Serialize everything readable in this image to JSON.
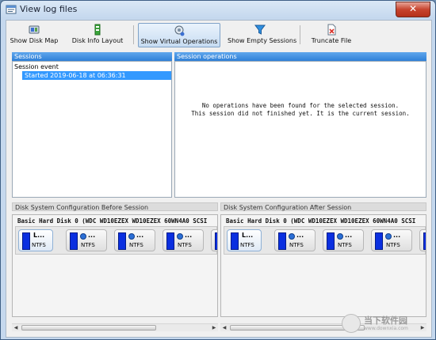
{
  "window": {
    "title": "View log files",
    "close_glyph": "✕"
  },
  "toolbar": {
    "buttons": [
      {
        "label": "Show Disk Map",
        "icon": "disk-map-icon",
        "active": false
      },
      {
        "label": "Disk Info Layout",
        "icon": "disk-info-icon",
        "active": false
      },
      {
        "label": "Show Virtual Operations",
        "icon": "virtual-ops-icon",
        "active": true
      },
      {
        "label": "Show Empty Sessions",
        "icon": "funnel-icon",
        "active": false
      },
      {
        "label": "Truncate File",
        "icon": "truncate-file-icon",
        "active": false
      }
    ]
  },
  "sessions": {
    "header": "Sessions",
    "root": "Session event",
    "selected_item": "Started 2019-06-18 at 06:36:31"
  },
  "operations": {
    "header": "Session operations",
    "message_line1": "No operations have been found for the selected session.",
    "message_line2": "This session did not finished yet. It is the current session."
  },
  "before": {
    "header": "Disk System Configuration Before Session",
    "disk_title": "Basic Hard Disk 0 (WDC WD10EZEX WD10EZEX 60WN4A0 SCSI",
    "first_part_label": "L...",
    "partitions": [
      {
        "dots": "...",
        "fs": "NTFS"
      },
      {
        "dots": "...",
        "fs": "NTFS"
      },
      {
        "dots": "...",
        "fs": "NTFS"
      },
      {
        "dots": "...",
        "fs": "NTFS"
      }
    ],
    "first_fs": "NTFS"
  },
  "after": {
    "header": "Disk System Configuration After Session",
    "disk_title": "Basic Hard Disk 0 (WDC WD10EZEX WD10EZEX 60WN4A0 SCSI",
    "first_part_label": "L...",
    "partitions": [
      {
        "dots": "...",
        "fs": "NTFS"
      },
      {
        "dots": "...",
        "fs": "NTFS"
      },
      {
        "dots": "...",
        "fs": "NTFS"
      },
      {
        "dots": "...",
        "fs": "NTFS"
      }
    ],
    "first_fs": "NTFS"
  },
  "watermark": {
    "text": "当下软件园",
    "sub": "www.downxia.com"
  },
  "colors": {
    "accent": "#3399ff",
    "partition_bar": "#0a2fe0",
    "close": "#c7442e"
  }
}
